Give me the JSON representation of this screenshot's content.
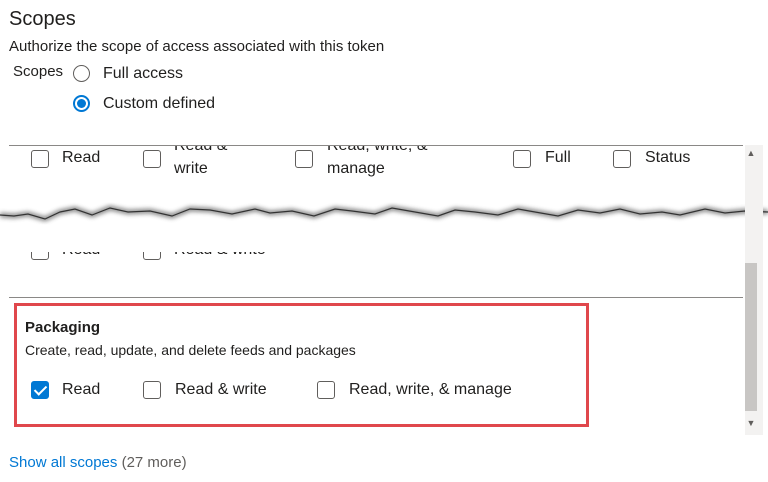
{
  "header": {
    "title": "Scopes",
    "subtitle": "Authorize the scope of access associated with this token",
    "scopes_label": "Scopes"
  },
  "scope_options": [
    {
      "label": "Full access",
      "selected": false
    },
    {
      "label": "Custom defined",
      "selected": true
    }
  ],
  "top_row": [
    {
      "label": "Read",
      "checked": false
    },
    {
      "label": "Read & write",
      "checked": false
    },
    {
      "label": "Read, write, & manage",
      "checked": false
    },
    {
      "label": "Full",
      "checked": false
    },
    {
      "label": "Status",
      "checked": false
    }
  ],
  "partial_row": [
    {
      "label": "Read"
    },
    {
      "label": "Read & write"
    }
  ],
  "packaging": {
    "title": "Packaging",
    "description": "Create, read, update, and delete feeds and packages",
    "options": [
      {
        "label": "Read",
        "checked": true
      },
      {
        "label": "Read & write",
        "checked": false
      },
      {
        "label": "Read, write, & manage",
        "checked": false
      }
    ]
  },
  "footer": {
    "link_text": "Show all scopes",
    "count_text": "(27 more)"
  },
  "colors": {
    "accent": "#0078d4",
    "highlight": "#e0474c",
    "text": "#201f1e"
  },
  "icons": {
    "scroll_up": "chevron-up-icon",
    "scroll_down": "chevron-down-icon"
  }
}
